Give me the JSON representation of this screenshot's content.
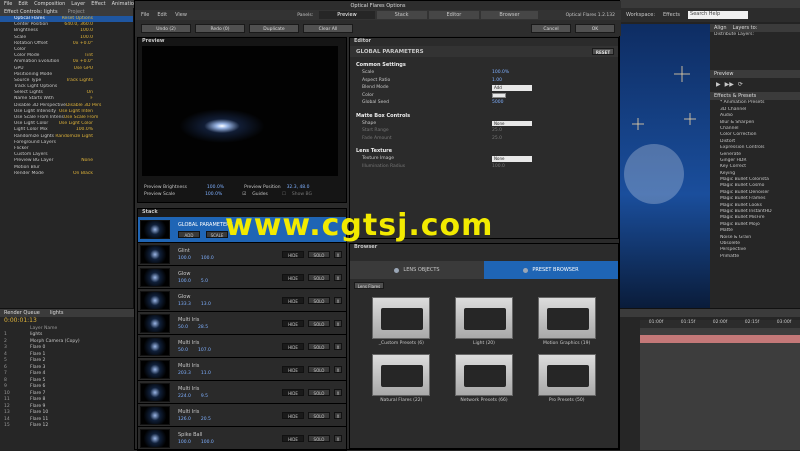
{
  "ae_menu": [
    "File",
    "Edit",
    "Composition",
    "Layer",
    "Effect",
    "Animation"
  ],
  "workspace_label": "Workspace:",
  "workspace_value": "Effects",
  "help_placeholder": "Search Help",
  "effect_controls_tab": "Effect Controls: lights",
  "project_tab": "Project",
  "effect_rows": [
    {
      "label": "Optical Flares",
      "value": "Reset   Options",
      "hl": true
    },
    {
      "label": "Center Position",
      "value": "640.0, 360.0"
    },
    {
      "label": "Brightness",
      "value": "100.0"
    },
    {
      "label": "Scale",
      "value": "100.0"
    },
    {
      "label": "Rotation Offset",
      "value": "0x +0.0°"
    },
    {
      "label": "Color",
      "value": ""
    },
    {
      "label": "Color Mode",
      "value": "Tint"
    },
    {
      "label": "Animation Evolution",
      "value": "0x +0.0°"
    },
    {
      "label": "GPU",
      "value": "Use GPU"
    },
    {
      "label": "Positioning Mode",
      "value": ""
    },
    {
      "label": "Source Type",
      "value": "Track Lights"
    },
    {
      "label": "Track Light Options",
      "value": ""
    },
    {
      "label": "Select Lights",
      "value": "On"
    },
    {
      "label": "Name Starts With",
      "value": "F"
    },
    {
      "label": "Disable 3D Perspective",
      "value": "Disable 3D Pers"
    },
    {
      "label": "Use Light Intensity",
      "value": "Use Light Inten"
    },
    {
      "label": "Use Scale From Intens",
      "value": "Use Scale From"
    },
    {
      "label": "Use Light Color",
      "value": "Use Light Color"
    },
    {
      "label": "Light Color Mix",
      "value": "100.0%"
    },
    {
      "label": "Randomize Lights",
      "value": "Randomize Light"
    },
    {
      "label": "Foreground Layers",
      "value": ""
    },
    {
      "label": "Flicker",
      "value": ""
    },
    {
      "label": "Custom Layers",
      "value": ""
    },
    {
      "label": "Preview BG Layer",
      "value": "None"
    },
    {
      "label": "Motion Blur",
      "value": ""
    },
    {
      "label": "Render Mode",
      "value": "On Black"
    }
  ],
  "timeline": {
    "tabs": [
      "Render Queue",
      "lights"
    ],
    "timecode": "0:00:01:13",
    "header": "Layer Name",
    "layers": [
      {
        "num": "1",
        "name": "lights"
      },
      {
        "num": "2",
        "name": "Morph Camera (Copy)"
      },
      {
        "num": "3",
        "name": "Flare 0"
      },
      {
        "num": "4",
        "name": "Flare 1"
      },
      {
        "num": "5",
        "name": "Flare 2"
      },
      {
        "num": "6",
        "name": "Flare 3"
      },
      {
        "num": "7",
        "name": "Flare 4"
      },
      {
        "num": "8",
        "name": "Flare 5"
      },
      {
        "num": "9",
        "name": "Flare 6"
      },
      {
        "num": "10",
        "name": "Flare 7"
      },
      {
        "num": "11",
        "name": "Flare 8"
      },
      {
        "num": "12",
        "name": "Flare 9"
      },
      {
        "num": "13",
        "name": "Flare 10"
      },
      {
        "num": "14",
        "name": "Flare 11"
      },
      {
        "num": "15",
        "name": "Flare 12"
      }
    ],
    "ruler": [
      "01:00f",
      "01:15f",
      "02:00f",
      "02:15f",
      "03:00f"
    ]
  },
  "right_panel": {
    "tabs": [
      "Align",
      "Layers to:"
    ],
    "distribute_label": "Distribute Layers:",
    "preview_tab": "Preview",
    "effects_tab": "Effects & Presets",
    "items": [
      "* Animation Presets",
      "3D Channel",
      "Audio",
      "Blur & Sharpen",
      "Channel",
      "Color Correction",
      "Distort",
      "Expression Controls",
      "Generate",
      "Ginger HDR",
      "Key Correct",
      "Keying",
      "Magic Bullet Colorista",
      "Magic Bullet Cosmo",
      "Magic Bullet Denoiser",
      "Magic Bullet Frames",
      "Magic Bullet Looks",
      "Magic Bullet InstantHD",
      "Magic Bullet MisFire",
      "Magic Bullet Mojo",
      "Matte",
      "Noise & Grain",
      "Obsolete",
      "Perspective",
      "Primatte"
    ]
  },
  "of_window": {
    "title": "Optical Flares Options",
    "menu": [
      "File",
      "Edit",
      "View"
    ],
    "panels_label": "Panels:",
    "tabs": [
      "Preview",
      "Stack",
      "Editor",
      "Browser"
    ],
    "version": "Optical Flares  1.2.132",
    "toolbar": [
      "Undo (2)",
      "Redo (0)",
      "Duplicate",
      "Clear All"
    ],
    "cancel": "Cancel",
    "ok": "OK"
  },
  "preview": {
    "header": "Preview",
    "brightness_label": "Preview Brightness",
    "brightness_value": "100.0%",
    "position_label": "Preview Position",
    "position_value": "32.3, 48.0",
    "scale_label": "Preview Scale",
    "scale_value": "100.0%",
    "guides_label": "Guides",
    "showbg_label": "Show BG"
  },
  "stack": {
    "header": "Stack",
    "global_title": "GLOBAL PARAMETERS",
    "add": "ADD",
    "scale": "SCALE",
    "hide": "HIDE",
    "solo": "SOLO",
    "x": "X",
    "rows": [
      {
        "name": "Glint",
        "a": "100.0",
        "b": "100.0",
        "sel": false
      },
      {
        "name": "Glow",
        "a": "100.0",
        "b": "5.0",
        "sel": false
      },
      {
        "name": "Glow",
        "a": "133.3",
        "b": "13.0",
        "sel": false
      },
      {
        "name": "Multi Iris",
        "a": "50.0",
        "b": "28.5",
        "sel": false
      },
      {
        "name": "Multi Iris",
        "a": "50.0",
        "b": "107.0",
        "sel": false
      },
      {
        "name": "Multi Iris",
        "a": "203.3",
        "b": "11.0",
        "sel": false
      },
      {
        "name": "Multi Iris",
        "a": "224.0",
        "b": "9.5",
        "sel": false
      },
      {
        "name": "Multi Iris",
        "a": "126.0",
        "b": "20.5",
        "sel": false
      },
      {
        "name": "Spike Ball",
        "a": "100.0",
        "b": "100.0",
        "sel": false
      }
    ]
  },
  "editor": {
    "header": "Editor",
    "title": "GLOBAL PARAMETERS",
    "reset": "RESET",
    "sections": [
      {
        "title": "Common Settings",
        "rows": [
          {
            "label": "Scale",
            "value": "100.0%",
            "type": "val"
          },
          {
            "label": "Aspect Ratio",
            "value": "1.00",
            "type": "val"
          },
          {
            "label": "Blend Mode",
            "value": "Add",
            "type": "dd"
          },
          {
            "label": "Color",
            "value": "",
            "type": "swatch"
          },
          {
            "label": "Global Seed",
            "value": "5000",
            "type": "val"
          }
        ]
      },
      {
        "title": "Matte Box Controls",
        "rows": [
          {
            "label": "Shape",
            "value": "None",
            "type": "dd"
          },
          {
            "label": "Start Range",
            "value": "25.0",
            "type": "dim"
          },
          {
            "label": "Fade Amount",
            "value": "25.0",
            "type": "dim"
          }
        ]
      },
      {
        "title": "Lens Texture",
        "rows": [
          {
            "label": "Texture Image",
            "value": "None",
            "type": "dd"
          },
          {
            "label": "Illumination Radius",
            "value": "100.0",
            "type": "dim"
          }
        ]
      }
    ]
  },
  "browser": {
    "header": "Browser",
    "lens_tab": "LENS OBJECTS",
    "preset_tab": "PRESET BROWSER",
    "breadcrumb": "Lens Flares",
    "folders": [
      "_Custom Presets (6)",
      "Light (20)",
      "Motion Graphics (19)",
      "Natural Flares (22)",
      "Network Presets (66)",
      "Pro Presets (50)"
    ]
  },
  "watermark": "www.cgtsj.com",
  "colors": {
    "accent": "#1f65b5",
    "value_blue": "#7fb0ff",
    "ae_value": "#e0b43a",
    "watermark": "#f2ea00"
  }
}
